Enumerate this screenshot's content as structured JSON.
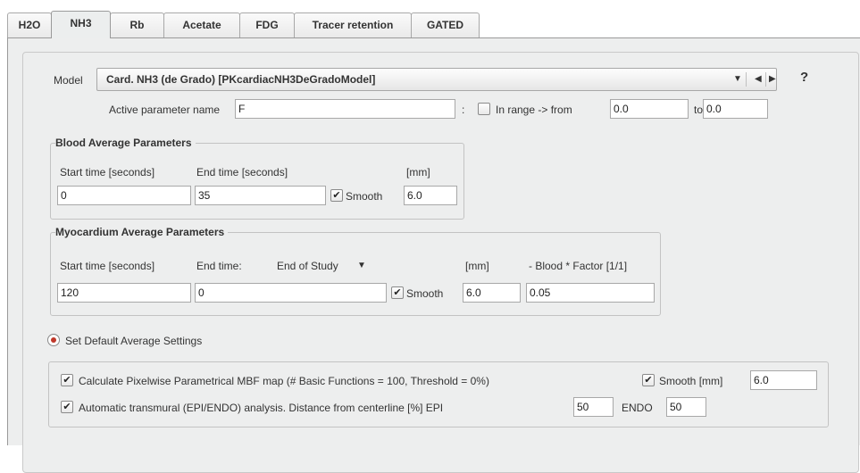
{
  "tabs": [
    {
      "label": "H2O",
      "active": false
    },
    {
      "label": "NH3",
      "active": true
    },
    {
      "label": "Rb",
      "active": false
    },
    {
      "label": "Acetate",
      "active": false
    },
    {
      "label": "FDG",
      "active": false
    },
    {
      "label": "Tracer retention",
      "active": false
    },
    {
      "label": "GATED",
      "active": false
    }
  ],
  "model": {
    "label": "Model",
    "value": "Card. NH3 (de Grado) [PKcardiacNH3DeGradoModel]",
    "dropdown_icon": "triangle-down-icon",
    "prev_icon": "triangle-left-icon",
    "next_icon": "triangle-right-icon",
    "help": "?"
  },
  "active_param": {
    "label": "Active parameter name",
    "value": "F",
    "colon": ":",
    "in_range_label": "In range  -> from",
    "in_range_checked": false,
    "from_value": "0.0",
    "to_label": "to",
    "to_value": "0.0"
  },
  "blood": {
    "title": "Blood Average Parameters",
    "start_label": "Start time [seconds]",
    "end_label": "End time [seconds]",
    "mm_label": "[mm]",
    "start_value": "0",
    "end_value": "35",
    "smooth_label": "Smooth",
    "smooth_checked": true,
    "mm_value": "6.0"
  },
  "myocardium": {
    "title": "Myocardium Average Parameters",
    "start_label": "Start time [seconds]",
    "end_label": "End time:",
    "end_mode": "End of Study",
    "mm_label": "[mm]",
    "factor_label": "- Blood * Factor [1/1]",
    "start_value": "120",
    "end_value": "0",
    "smooth_label": "Smooth",
    "smooth_checked": true,
    "mm_value": "6.0",
    "factor_value": "0.05"
  },
  "default_settings": {
    "label": "Set Default Average Settings",
    "selected": true
  },
  "options": {
    "pixelwise_label": "Calculate Pixelwise Parametrical MBF map (# Basic Functions = 100, Threshold = 0%)",
    "pixelwise_checked": true,
    "smooth_label": "Smooth [mm]",
    "smooth_checked": true,
    "smooth_value": "6.0",
    "transmural_label": "Automatic transmural (EPI/ENDO) analysis.  Distance from centerline [%] EPI",
    "transmural_checked": true,
    "epi_value": "50",
    "endo_label": "ENDO",
    "endo_value": "50"
  },
  "check_glyph": "✔"
}
